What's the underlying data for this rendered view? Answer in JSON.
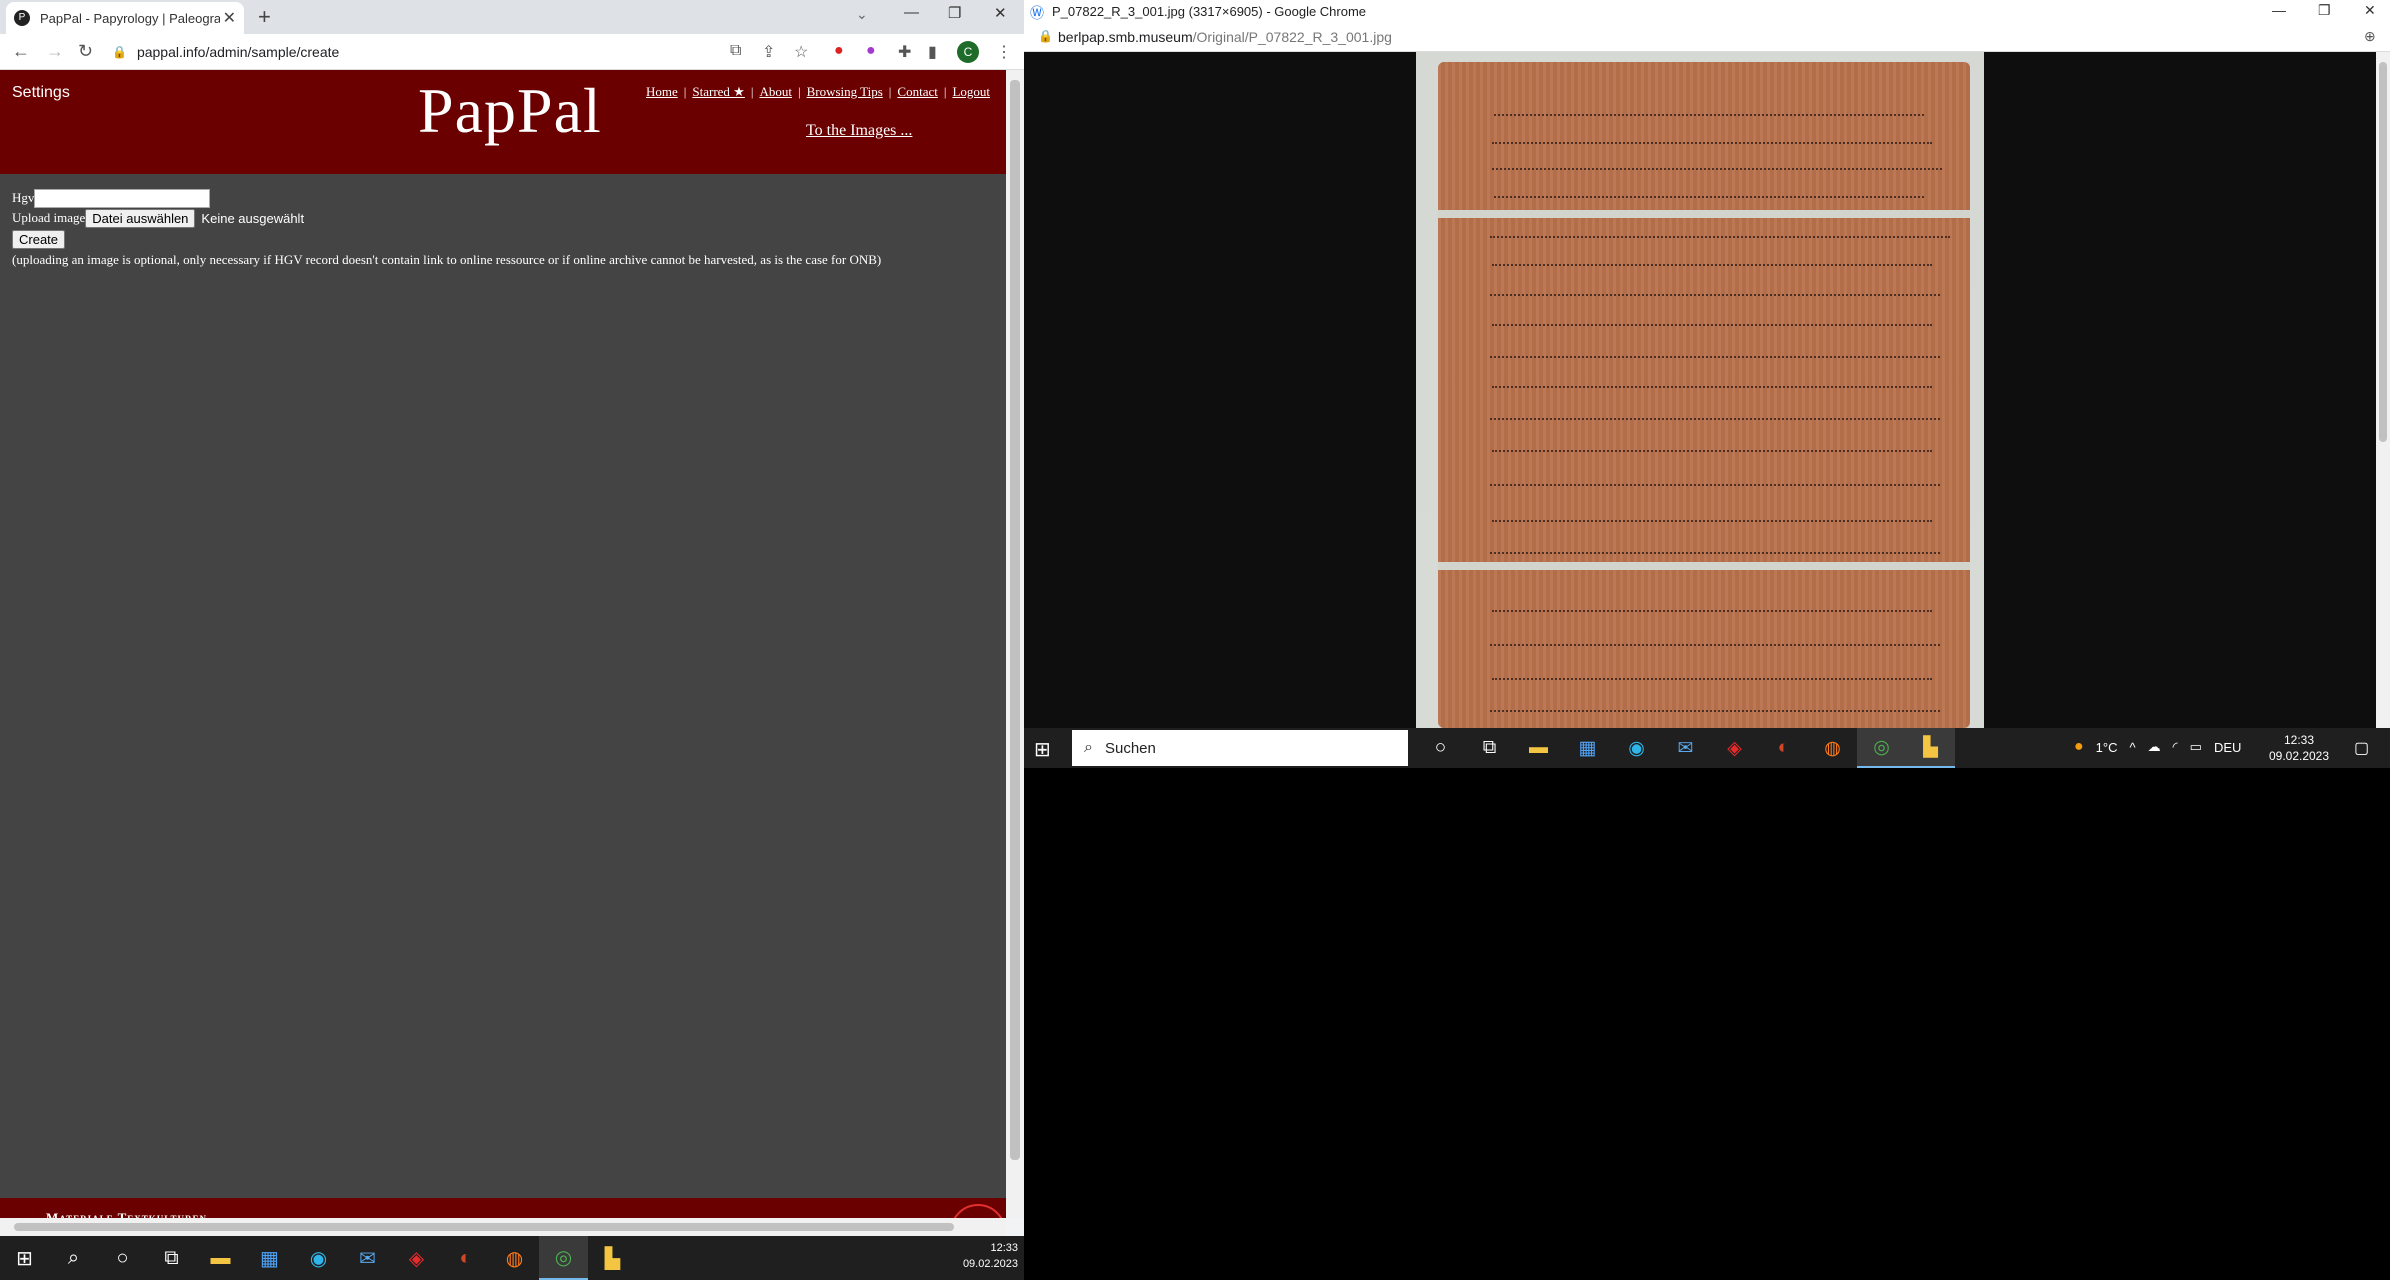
{
  "left_browser": {
    "tab_title": "PapPal - Papyrology | Paleography",
    "tab_favicon": "P",
    "url": "pappal.info/admin/sample/create",
    "profile_initial": "C"
  },
  "site": {
    "settings": "Settings",
    "logo": "PapPal",
    "nav": [
      "Home",
      "Starred ★",
      "About",
      "Browsing Tips",
      "Contact",
      "Logout"
    ],
    "to_images": "To the Images ...",
    "hgv_label": "Hgv",
    "upload_label": "Upload image",
    "file_button": "Datei auswählen",
    "file_status": "Keine ausgewählt",
    "create_button": "Create",
    "note": "(uploading an image is optional, only necessary if HGV record doesn't contain link to online ressource or if online archive cannot be harvested, as is the case for ONB)",
    "footer": "Materiale Textkulturen"
  },
  "left_taskbar": {
    "time": "12:33",
    "date": "09.02.2023"
  },
  "right_browser": {
    "title": "P_07822_R_3_001.jpg (3317×6905) - Google Chrome",
    "url_host": "berlpap.smb.museum",
    "url_path": "/Original/P_07822_R_3_001.jpg"
  },
  "right_taskbar": {
    "search": "Suchen",
    "weather": "1°C",
    "lang": "DEU",
    "time": "12:33",
    "date": "09.02.2023"
  }
}
